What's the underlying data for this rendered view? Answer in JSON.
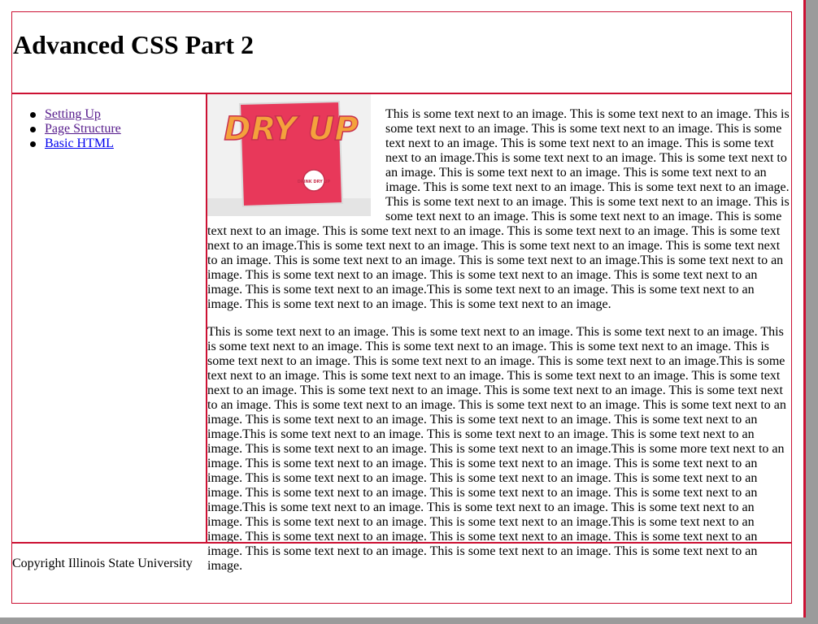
{
  "header": {
    "title": "Advanced CSS Part 2"
  },
  "nav": {
    "items": [
      {
        "label": "Setting Up"
      },
      {
        "label": "Page Structure"
      },
      {
        "label": "Basic HTML"
      }
    ]
  },
  "main": {
    "image": {
      "icon": "dry-up-sticker-image",
      "text": "DRY UP",
      "badge": "DRINK DRY UP"
    },
    "paragraph_1": "This is some text next to an image. This is some text next to an image. This is some text next to an image. This is some text next to an image. This is some text next to an image. This is some text next to an image. This is some text next to an image.This is some text next to an image. This is some text next to an image. This is some text next to an image. This is some text next to an image. This is some text next to an image. This is some text next to an image. This is some text next to an image. This is some text next to an image. This is some text next to an image. This is some text next to an image. This is some text next to an image. This is some text next to an image. This is some text next to an image. This is some text next to an image.This is some text next to an image. This is some text next to an image. This is some text next to an image. This is some text next to an image. This is some text next to an image.This is some text next to an image. This is some text next to an image. This is some text next to an image. This is some text next to an image. This is some text next to an image.This is some text next to an image. This is some text next to an image. This is some text next to an image. This is some text next to an image.",
    "paragraph_2": "This is some text next to an image. This is some text next to an image. This is some text next to an image. This is some text next to an image. This is some text next to an image. This is some text next to an image. This is some text next to an image. This is some text next to an image. This is some text next to an image.This is some text next to an image. This is some text next to an image. This is some text next to an image. This is some text next to an image. This is some text next to an image. This is some text next to an image. This is some text next to an image. This is some text next to an image. This is some text next to an image. This is some text next to an image. This is some text next to an image. This is some text next to an image. This is some text next to an image.This is some text next to an image. This is some text next to an image. This is some text next to an image. This is some text next to an image. This is some text next to an image.This is some more text next to an image. This is some text next to an image. This is some text next to an image. This is some text next to an image. This is some text next to an image. This is some text next to an image. This is some text next to an image. This is some text next to an image. This is some text next to an image. This is some text next to an image.This is some text next to an image. This is some text next to an image. This is some text next to an image. This is some text next to an image. This is some text next to an image.This is some text next to an image. This is some text next to an image. This is some text next to an image. This is some text next to an image. This is some text next to an image. This is some text next to an image. This is some text next to an image."
  },
  "footer": {
    "text": "Copyright Illinois State University"
  },
  "colors": {
    "border": "#cc1133",
    "sticker_red": "#e8385a",
    "sticker_orange": "#f4a23c",
    "link_visited": "#551a8b",
    "link_new": "#0000ee"
  }
}
